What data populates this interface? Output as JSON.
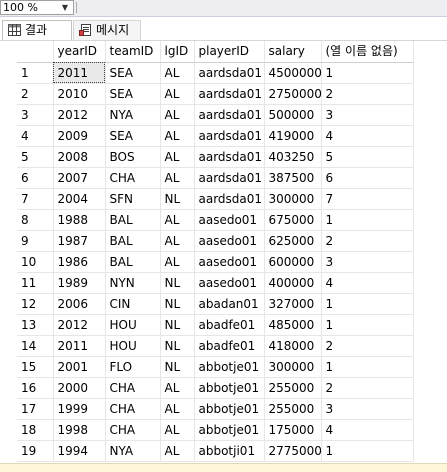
{
  "zoom": {
    "value": "100 %"
  },
  "tabs": [
    {
      "label": "결과",
      "icon": "grid-icon"
    },
    {
      "label": "메시지",
      "icon": "message-icon"
    }
  ],
  "grid": {
    "columns": [
      "yearID",
      "teamID",
      "lgID",
      "playerID",
      "salary",
      "(열 이름 없음)"
    ],
    "rows": [
      [
        "1",
        "2011",
        "SEA",
        "AL",
        "aardsda01",
        "4500000",
        "1"
      ],
      [
        "2",
        "2010",
        "SEA",
        "AL",
        "aardsda01",
        "2750000",
        "2"
      ],
      [
        "3",
        "2012",
        "NYA",
        "AL",
        "aardsda01",
        "500000",
        "3"
      ],
      [
        "4",
        "2009",
        "SEA",
        "AL",
        "aardsda01",
        "419000",
        "4"
      ],
      [
        "5",
        "2008",
        "BOS",
        "AL",
        "aardsda01",
        "403250",
        "5"
      ],
      [
        "6",
        "2007",
        "CHA",
        "AL",
        "aardsda01",
        "387500",
        "6"
      ],
      [
        "7",
        "2004",
        "SFN",
        "NL",
        "aardsda01",
        "300000",
        "7"
      ],
      [
        "8",
        "1988",
        "BAL",
        "AL",
        "aasedo01",
        "675000",
        "1"
      ],
      [
        "9",
        "1987",
        "BAL",
        "AL",
        "aasedo01",
        "625000",
        "2"
      ],
      [
        "10",
        "1986",
        "BAL",
        "AL",
        "aasedo01",
        "600000",
        "3"
      ],
      [
        "11",
        "1989",
        "NYN",
        "NL",
        "aasedo01",
        "400000",
        "4"
      ],
      [
        "12",
        "2006",
        "CIN",
        "NL",
        "abadan01",
        "327000",
        "1"
      ],
      [
        "13",
        "2012",
        "HOU",
        "NL",
        "abadfe01",
        "485000",
        "1"
      ],
      [
        "14",
        "2011",
        "HOU",
        "NL",
        "abadfe01",
        "418000",
        "2"
      ],
      [
        "15",
        "2001",
        "FLO",
        "NL",
        "abbotje01",
        "300000",
        "1"
      ],
      [
        "16",
        "2000",
        "CHA",
        "AL",
        "abbotje01",
        "255000",
        "2"
      ],
      [
        "17",
        "1999",
        "CHA",
        "AL",
        "abbotje01",
        "255000",
        "3"
      ],
      [
        "18",
        "1998",
        "CHA",
        "AL",
        "abbotje01",
        "175000",
        "4"
      ],
      [
        "19",
        "1994",
        "NYA",
        "AL",
        "abbotji01",
        "2775000",
        "1"
      ]
    ]
  }
}
